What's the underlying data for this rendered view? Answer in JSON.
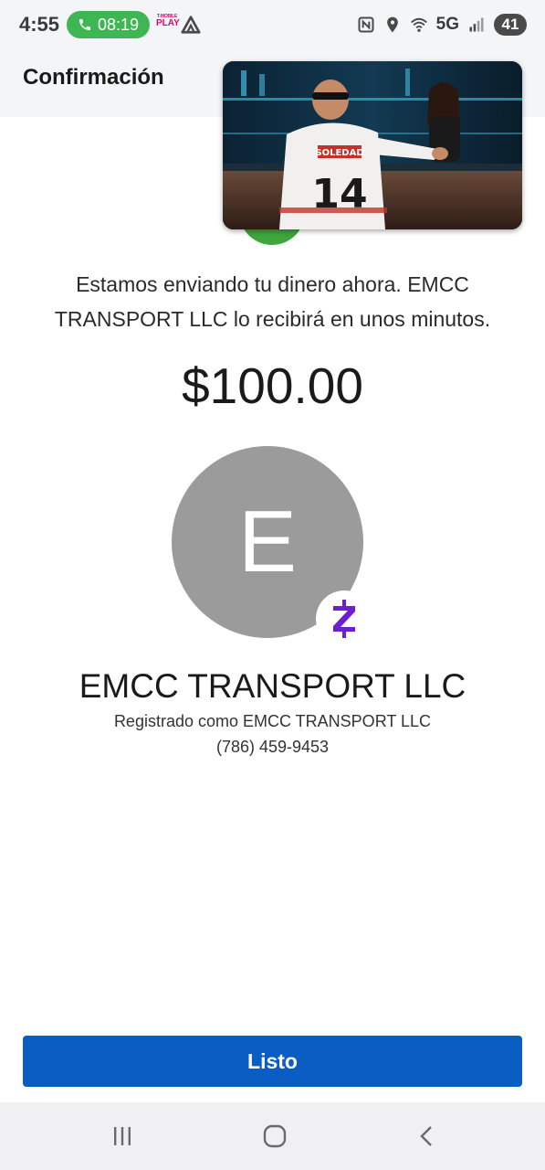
{
  "status_bar": {
    "time": "4:55",
    "call_timer": "08:19",
    "carrier_small": "T-MOBILE",
    "carrier_big": "PLAY",
    "network": "5G",
    "battery": "41"
  },
  "header": {
    "title": "Confirmación"
  },
  "confirmation": {
    "message": "Estamos enviando tu dinero ahora. EMCC TRANSPORT LLC lo recibirá en unos minutos.",
    "amount": "$100.00"
  },
  "recipient": {
    "initial": "E",
    "name": "EMCC TRANSPORT LLC",
    "registered_as": "Registrado como EMCC TRANSPORT LLC",
    "phone": "(786) 459-9453",
    "badge_icon": "zelle-icon"
  },
  "actions": {
    "done_label": "Listo"
  },
  "video_overlay": {
    "jersey_text": "SOLEDAD",
    "jersey_number": "14"
  },
  "colors": {
    "accent": "#0a5dc2",
    "zelle": "#6d1ed4",
    "success": "#3ea63c",
    "call_pill": "#3fb654",
    "avatar": "#9b9b9b"
  }
}
